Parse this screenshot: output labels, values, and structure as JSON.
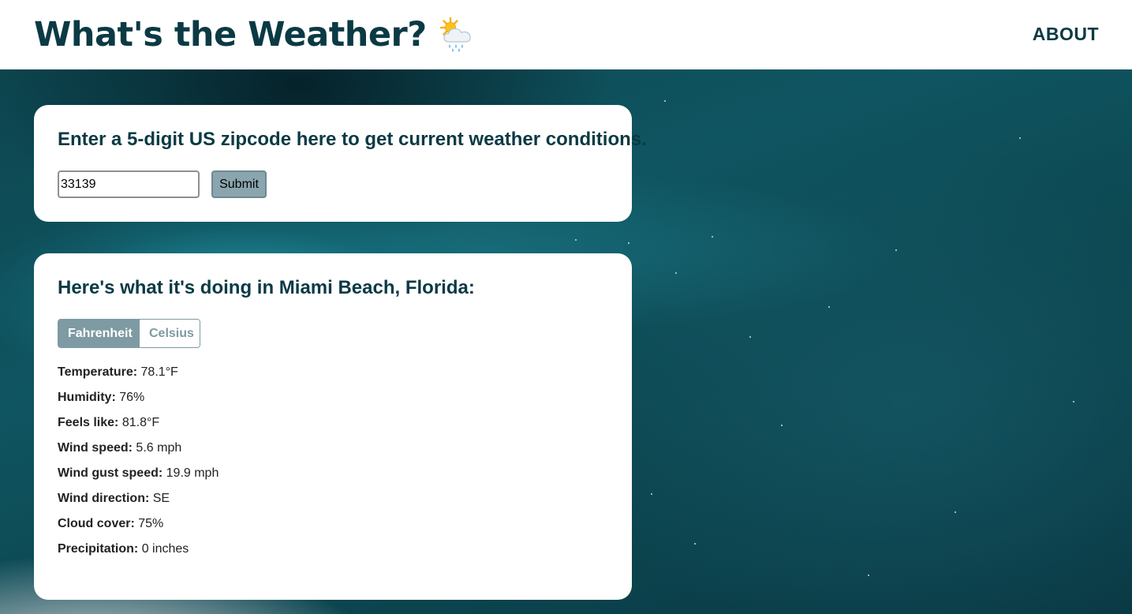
{
  "header": {
    "title": "What's the Weather?",
    "title_icon": "sun-behind-rain-cloud-icon",
    "nav_about": "ABOUT"
  },
  "search": {
    "prompt": "Enter a 5-digit US zipcode here to get current weather conditions.",
    "zip_value": "33139",
    "submit_label": "Submit"
  },
  "results": {
    "heading": "Here's what it's doing in Miami Beach, Florida:",
    "units": {
      "fahrenheit": "Fahrenheit",
      "celsius": "Celsius",
      "selected": "Fahrenheit"
    },
    "stats": [
      {
        "label": "Temperature:",
        "value": "78.1°F"
      },
      {
        "label": "Humidity:",
        "value": "76%"
      },
      {
        "label": "Feels like:",
        "value": "81.8°F"
      },
      {
        "label": "Wind speed:",
        "value": "5.6 mph"
      },
      {
        "label": "Wind gust speed:",
        "value": "19.9 mph"
      },
      {
        "label": "Wind direction:",
        "value": "SE"
      },
      {
        "label": "Cloud cover:",
        "value": "75%"
      },
      {
        "label": "Precipitation:",
        "value": "0 inches"
      }
    ]
  },
  "colors": {
    "primary_text": "#0b3a44",
    "accent": "#7e9aa2",
    "card_bg": "#ffffff"
  }
}
